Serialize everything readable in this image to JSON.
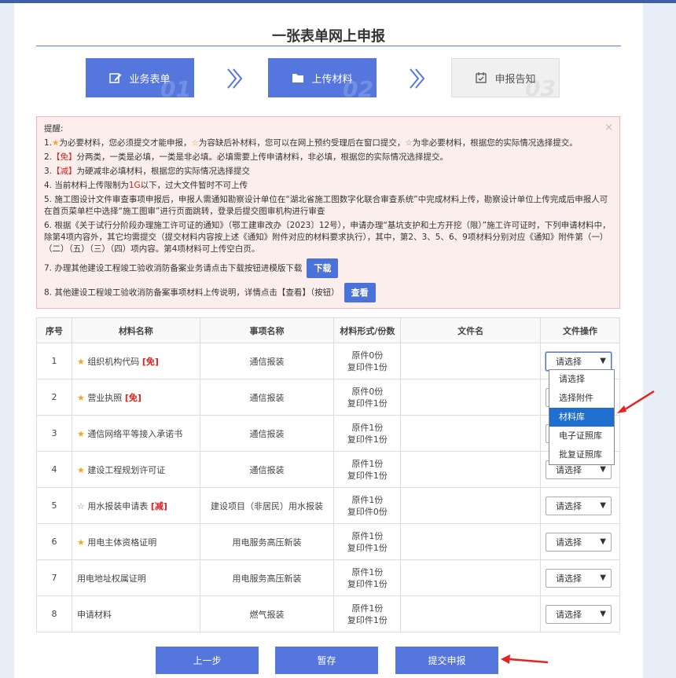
{
  "title": "一张表单网上申报",
  "steps": [
    {
      "label": "业务表单",
      "num": "01",
      "icon": "edit-icon"
    },
    {
      "label": "上传材料",
      "num": "02",
      "icon": "folder-icon"
    },
    {
      "label": "申报告知",
      "num": "03",
      "icon": "calendar-icon"
    }
  ],
  "notice": {
    "heading": "提醒:",
    "l1_a": "1.",
    "l1_b": "为必要材料，您必须提交才能申报，",
    "l1_c": "为容缺后补材料，您可以在网上预约受理后在窗口提交，",
    "l1_d": "为非必要材料，根据您的实际情况选择提交。",
    "l2_a": "2.",
    "l2_tag": "【免】",
    "l2_b": "分两类，一类是必填，一类是非必填。必填需要上传申请材料，非必填，根据您的实际情况选择提交。",
    "l3_a": "3.",
    "l3_tag": "【减】",
    "l3_b": "为硬减非必填材料，根据您的实际情况选择提交",
    "l4_a": "4. 当前材料上传限制为",
    "l4_tag": "1G",
    "l4_b": "以下，过大文件暂时不可上传",
    "l5": "5. 施工图设计文件审查事项申报后，申报人需通知勘察设计单位在“湖北省施工图数字化联合审查系统”中完成材料上传，勘察设计单位上传完成后申报人可在首页菜单栏中选择“施工图审”进行页面跳转，登录后提交图审机构进行审查",
    "l6": "6. 根据《关于试行分阶段办理施工许可证的通知》（鄂工建审改办〔2023〕12号），申请办理“基坑支护和土方开挖（限）”施工许可证时，下列申请材料中，除第4项内容外，其它均需提交（提交材料内容按上述《通知》附件对应的材料要求执行），其中，第2、3、5、6、9项材料分别对应《通知》附件第（一）（二）（五）（三）（四）项内容。第4项材料可上传空白页。",
    "l7": "7. 办理其他建设工程竣工验收消防备案业务请点击下载按钮进模版下载",
    "l7_btn": "下载",
    "l8": "8. 其他建设工程竣工验收消防备案事项材料上传说明，详情点击【查看】（按钮）",
    "l8_btn": "查看",
    "close": "×"
  },
  "table": {
    "headers": [
      "序号",
      "材料名称",
      "事项名称",
      "材料形式/份数",
      "文件名",
      "文件操作"
    ],
    "rows": [
      {
        "no": "1",
        "star": "★",
        "name": "组织机构代码",
        "tag": "[免]",
        "item": "通信报装",
        "orig": "原件0份",
        "copy": "复印件1份",
        "select": "请选择"
      },
      {
        "no": "2",
        "star": "★",
        "name": "营业执照",
        "tag": "[免]",
        "item": "通信报装",
        "orig": "原件0份",
        "copy": "复印件1份",
        "select": "请选择"
      },
      {
        "no": "3",
        "star": "★",
        "name": "通信网络平等接入承诺书",
        "tag": "",
        "item": "通信报装",
        "orig": "原件1份",
        "copy": "复印件1份",
        "select": "请选择"
      },
      {
        "no": "4",
        "star": "★",
        "name": "建设工程规划许可证",
        "tag": "",
        "item": "通信报装",
        "orig": "原件1份",
        "copy": "复印件1份",
        "select": "请选择"
      },
      {
        "no": "5",
        "star": "☆",
        "name": "用水报装申请表",
        "tag": "[减]",
        "item": "建设项目（非居民）用水报装",
        "orig": "原件1份",
        "copy": "复印件0份",
        "select": "请选择"
      },
      {
        "no": "6",
        "star": "★",
        "name": "用电主体资格证明",
        "tag": "",
        "item": "用电服务高压新装",
        "orig": "原件1份",
        "copy": "复印件1份",
        "select": "请选择"
      },
      {
        "no": "7",
        "star": "",
        "name": "用电地址权属证明",
        "tag": "",
        "item": "用电服务高压新装",
        "orig": "原件1份",
        "copy": "复印件1份",
        "select": "请选择"
      },
      {
        "no": "8",
        "star": "",
        "name": "申请材料",
        "tag": "",
        "item": "燃气报装",
        "orig": "原件1份",
        "copy": "复印件1份",
        "select": "请选择"
      }
    ]
  },
  "dropdown": {
    "options": [
      "请选择",
      "选择附件",
      "材料库",
      "电子证照库",
      "批复证照库"
    ],
    "highlighted": "材料库"
  },
  "buttons": {
    "prev": "上一步",
    "save": "暂存",
    "submit": "提交申报"
  },
  "colors": {
    "accent": "#5576dd",
    "red": "#e02020",
    "star": "#f5a623"
  }
}
